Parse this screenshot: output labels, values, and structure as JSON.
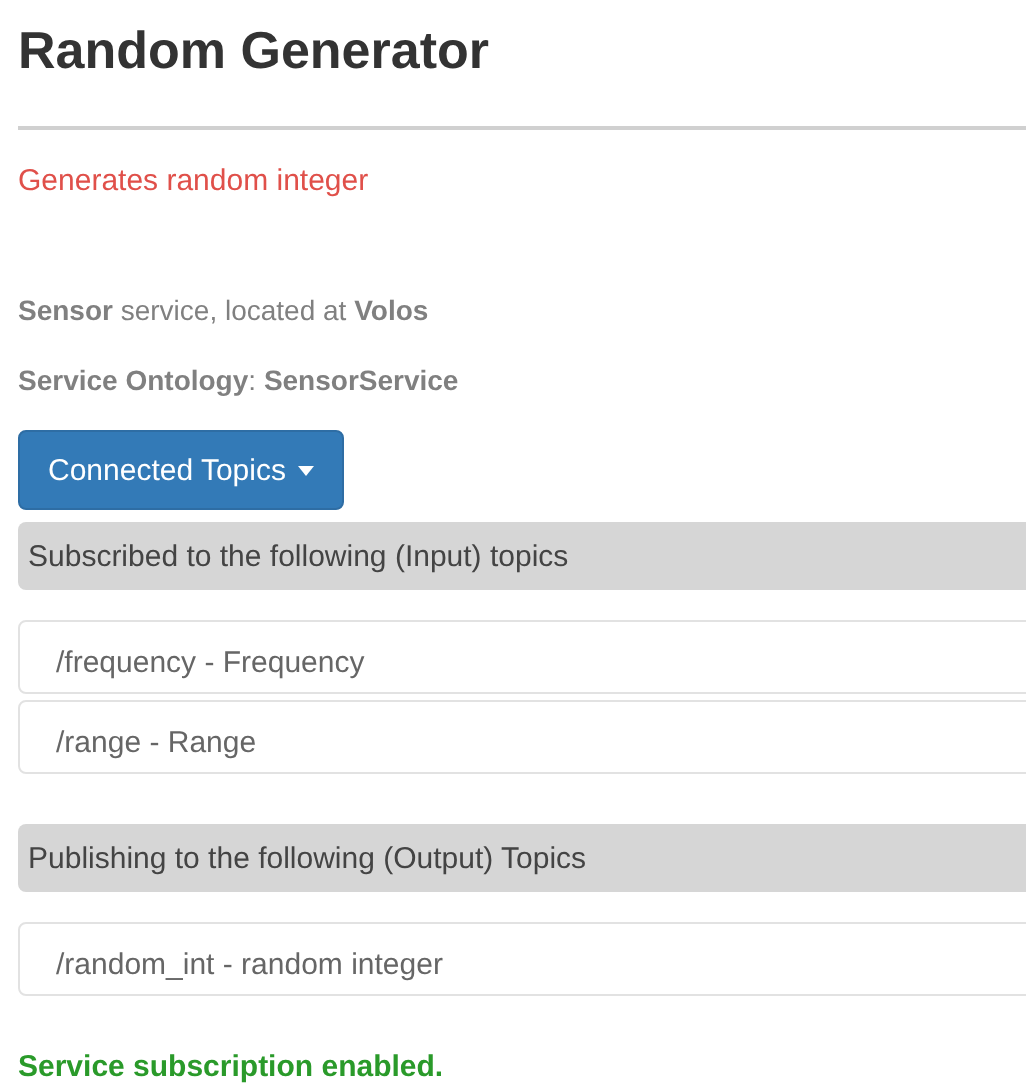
{
  "title": "Random Generator",
  "description": "Generates random integer",
  "location": "**Sensor** service, located at **Volos**",
  "ontology": "**Service Ontology**: **SensorService**",
  "topics_button": {
    "label": "Connected Topics",
    "expanded": true
  },
  "sections": [
    {
      "heading": "Subscribed to the following (Input) topics",
      "topics": [
        "/frequency - Frequency",
        "/range - Range"
      ]
    },
    {
      "heading": "Publishing to the following (Output) Topics",
      "topics": [
        "/random_int - random integer"
      ]
    }
  ],
  "status": "Service subscription enabled."
}
